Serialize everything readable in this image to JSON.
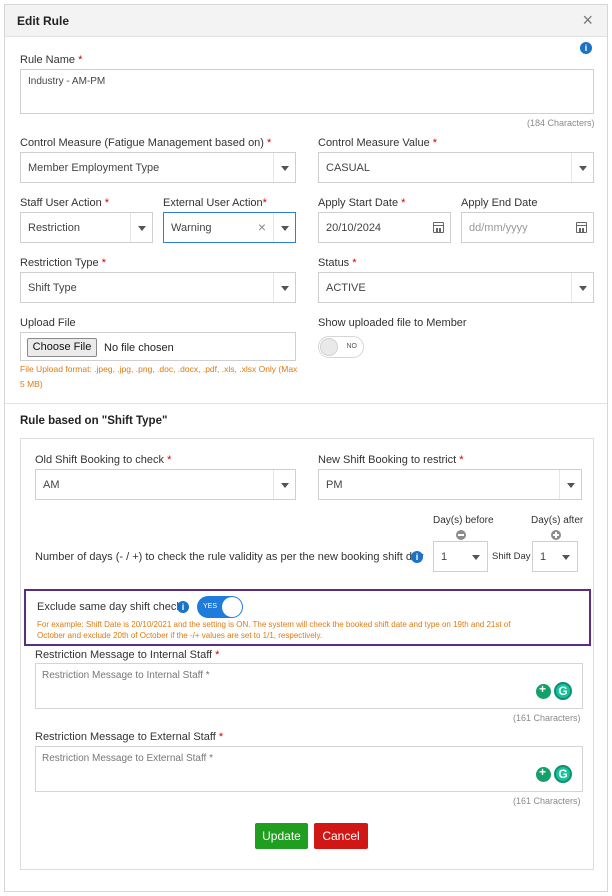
{
  "modal": {
    "title": "Edit Rule",
    "close": "×"
  },
  "rule_name": {
    "label": "Rule Name",
    "value": "Industry - AM-PM",
    "count": "(184 Characters)"
  },
  "control_measure": {
    "label": "Control Measure (Fatigue Management based on)",
    "value": "Member Employment Type"
  },
  "control_measure_value": {
    "label": "Control Measure Value",
    "value": "CASUAL"
  },
  "staff_user_action": {
    "label": "Staff User Action",
    "value": "Restriction"
  },
  "external_user_action": {
    "label": "External User Action",
    "value": "Warning"
  },
  "apply_start_date": {
    "label": "Apply Start Date",
    "value": "20/10/2024"
  },
  "apply_end_date": {
    "label": "Apply End Date",
    "placeholder": "dd/mm/yyyy"
  },
  "restriction_type": {
    "label": "Restriction Type",
    "value": "Shift Type"
  },
  "status": {
    "label": "Status",
    "value": "ACTIVE"
  },
  "upload": {
    "label": "Upload File",
    "button": "Choose File",
    "file_text": "No file chosen",
    "hint_line1": "File Upload format: .jpeg, .jpg, .png, .doc, .docx, .pdf, .xls, .xlsx Only (Max",
    "hint_line2": "5 MB)"
  },
  "show_file": {
    "label": "Show uploaded file to Member",
    "toggle": "NO",
    "on": false
  },
  "section": {
    "title": "Rule based on \"Shift Type\""
  },
  "old_shift": {
    "label": "Old Shift Booking to check",
    "value": "AM"
  },
  "new_shift": {
    "label": "New Shift Booking to restrict",
    "value": "PM"
  },
  "days": {
    "label": "Number of days (- / +) to check the rule validity as per the new booking shift day",
    "before_label": "Day(s) before",
    "before_value": "1",
    "middle": "Shift Day",
    "after_label": "Day(s) after",
    "after_value": "1"
  },
  "exclude": {
    "label": "Exclude same day shift check",
    "toggle": "YES",
    "on": true,
    "example_line1": "For example: Shift Date is 20/10/2021 and the setting is ON. The system will check the booked shift date and type on 19th and 21st of",
    "example_line2": "October and exclude 20th of October if the -/+ values are set to 1/1, respectively."
  },
  "internal_msg": {
    "label": "Restriction Message to Internal Staff",
    "placeholder": "Restriction Message to Internal Staff *",
    "count": "(161 Characters)"
  },
  "external_msg": {
    "label": "Restriction Message to External Staff",
    "placeholder": "Restriction Message to External Staff *",
    "count": "(161 Characters)"
  },
  "buttons": {
    "update": "Update",
    "cancel": "Cancel"
  },
  "colors": {
    "primary": "#1f7bdc",
    "update": "#1f9e1f",
    "cancel": "#d11616",
    "highlight": "#5a2d86",
    "hint": "#e07a10"
  }
}
